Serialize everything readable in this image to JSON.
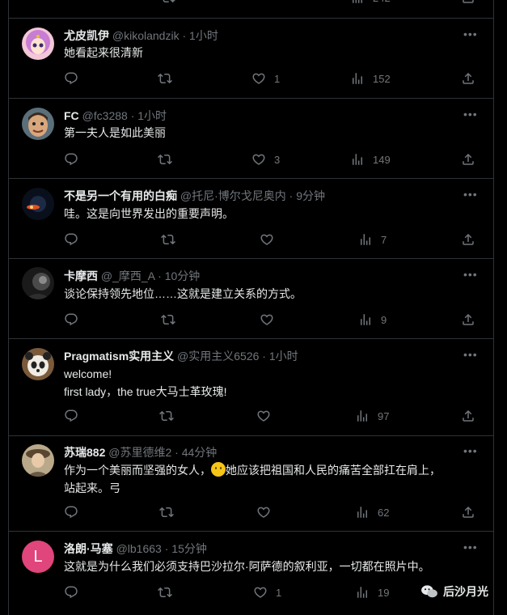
{
  "top_partial": {
    "views": "242"
  },
  "tweets": [
    {
      "name": "尤皮凯伊",
      "handle": "@kikolandzik",
      "time": "1小时",
      "lines": [
        "她看起来很清新"
      ],
      "likes": "1",
      "views": "152",
      "avatar": "avatar-sailor-moon"
    },
    {
      "name": "FC",
      "handle": "@fc3288",
      "time": "1小时",
      "lines": [
        "第一夫人是如此美丽"
      ],
      "likes": "3",
      "views": "149",
      "avatar": "avatar-cartoon-character"
    },
    {
      "name": "不是另一个有用的白痴",
      "handle": "@托尼·博尔戈尼奥内",
      "time": "9分钟",
      "lines": [
        "哇。这是向世界发出的重要声明。"
      ],
      "likes": "",
      "views": "7",
      "avatar": "avatar-eclipse"
    },
    {
      "name": "卡摩西",
      "handle": "@_摩西_A",
      "time": "10分钟",
      "lines": [
        "谈论保持领先地位……这就是建立关系的方式。"
      ],
      "likes": "",
      "views": "9",
      "avatar": "avatar-dark"
    },
    {
      "name": "Pragmatism实用主义",
      "handle": "@实用主义6526",
      "time": "1小时",
      "lines": [
        "welcome!",
        "first lady，the true大马士革玫瑰!"
      ],
      "likes": "",
      "views": "97",
      "avatar": "avatar-panda"
    },
    {
      "name": "苏瑞882",
      "handle": "@苏里德维2",
      "time": "44分钟",
      "lines": [
        "作为一个美丽而坚强的女人，",
        "站起来。弓"
      ],
      "line1_after_emoji": "她应该把祖国和人民的痛苦全部扛在肩上，",
      "likes": "",
      "views": "62",
      "avatar": "avatar-portrait"
    },
    {
      "name": "洛朗·马塞",
      "handle": "@lb1663",
      "time": "15分钟",
      "lines": [
        "这就是为什么我们必须支持巴沙拉尔·阿萨德的叙利亚，一切都在照片中。"
      ],
      "likes": "1",
      "views": "19",
      "avatar": "avatar-letter-l",
      "avatar_letter": "L"
    }
  ],
  "separator_dot": "·",
  "watermark": {
    "text": "后沙月光"
  },
  "colors": {
    "background": "#000000",
    "text": "#e7e9ea",
    "muted": "#71767b",
    "border": "#2f3336",
    "avatar_l": "#e0457b"
  }
}
